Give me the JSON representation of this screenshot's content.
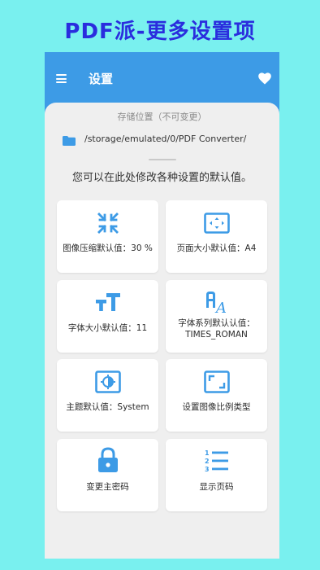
{
  "promo_title": "PDF派-更多设置项",
  "appbar": {
    "title": "设置"
  },
  "storage": {
    "label": "存储位置（不可变更）",
    "path": "/storage/emulated/0/PDF Converter/"
  },
  "hint": "您可以在此处修改各种设置的默认值。",
  "colors": {
    "accent": "#3d9be6",
    "icon": "#3d9be6",
    "title": "#2a2dde",
    "background": "#79f0ef"
  },
  "cards": [
    {
      "label": "图像压缩默认值：30 %",
      "icon": "compress-icon"
    },
    {
      "label": "页面大小默认值：A4",
      "icon": "page-size-icon"
    },
    {
      "label": "字体大小默认值：11",
      "icon": "font-size-icon"
    },
    {
      "label_line1": "字体系列默认认值：",
      "label_line2": "TIMES_ROMAN",
      "icon": "font-family-icon"
    },
    {
      "label": "主题默认值：System",
      "icon": "theme-icon"
    },
    {
      "label": "设置图像比例类型",
      "icon": "aspect-ratio-icon"
    },
    {
      "label": "变更主密码",
      "icon": "lock-icon"
    },
    {
      "label": "显示页码",
      "icon": "numbered-list-icon"
    }
  ]
}
